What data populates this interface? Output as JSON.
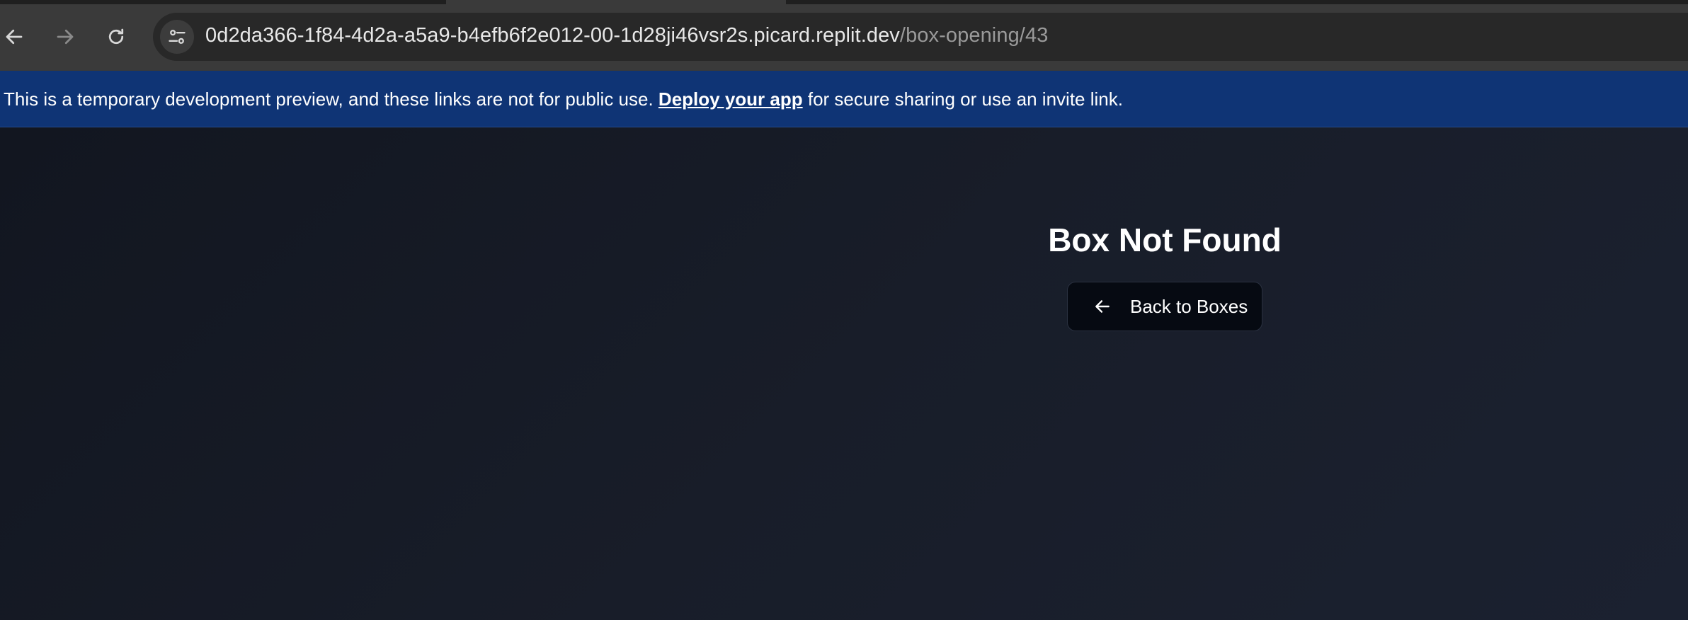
{
  "browser": {
    "url_host": "0d2da366-1f84-4d2a-a5a9-b4efb6f2e012-00-1d28ji46vsr2s.picard.replit.dev",
    "url_path": "/box-opening/43"
  },
  "banner": {
    "text_before": "This is a temporary development preview, and these links are not for public use. ",
    "link_label": "Deploy your app",
    "text_after": " for secure sharing or use an invite link."
  },
  "main": {
    "title": "Box Not Found",
    "back_button_label": "Back to Boxes"
  },
  "colors": {
    "banner_bg": "#0f3475",
    "page_bg": "#161a24",
    "button_bg": "#060a12"
  },
  "icons": {
    "back": "arrow-left-icon",
    "forward": "arrow-right-icon",
    "reload": "reload-icon",
    "site_info": "tune-icon",
    "button": "arrow-left-icon"
  }
}
